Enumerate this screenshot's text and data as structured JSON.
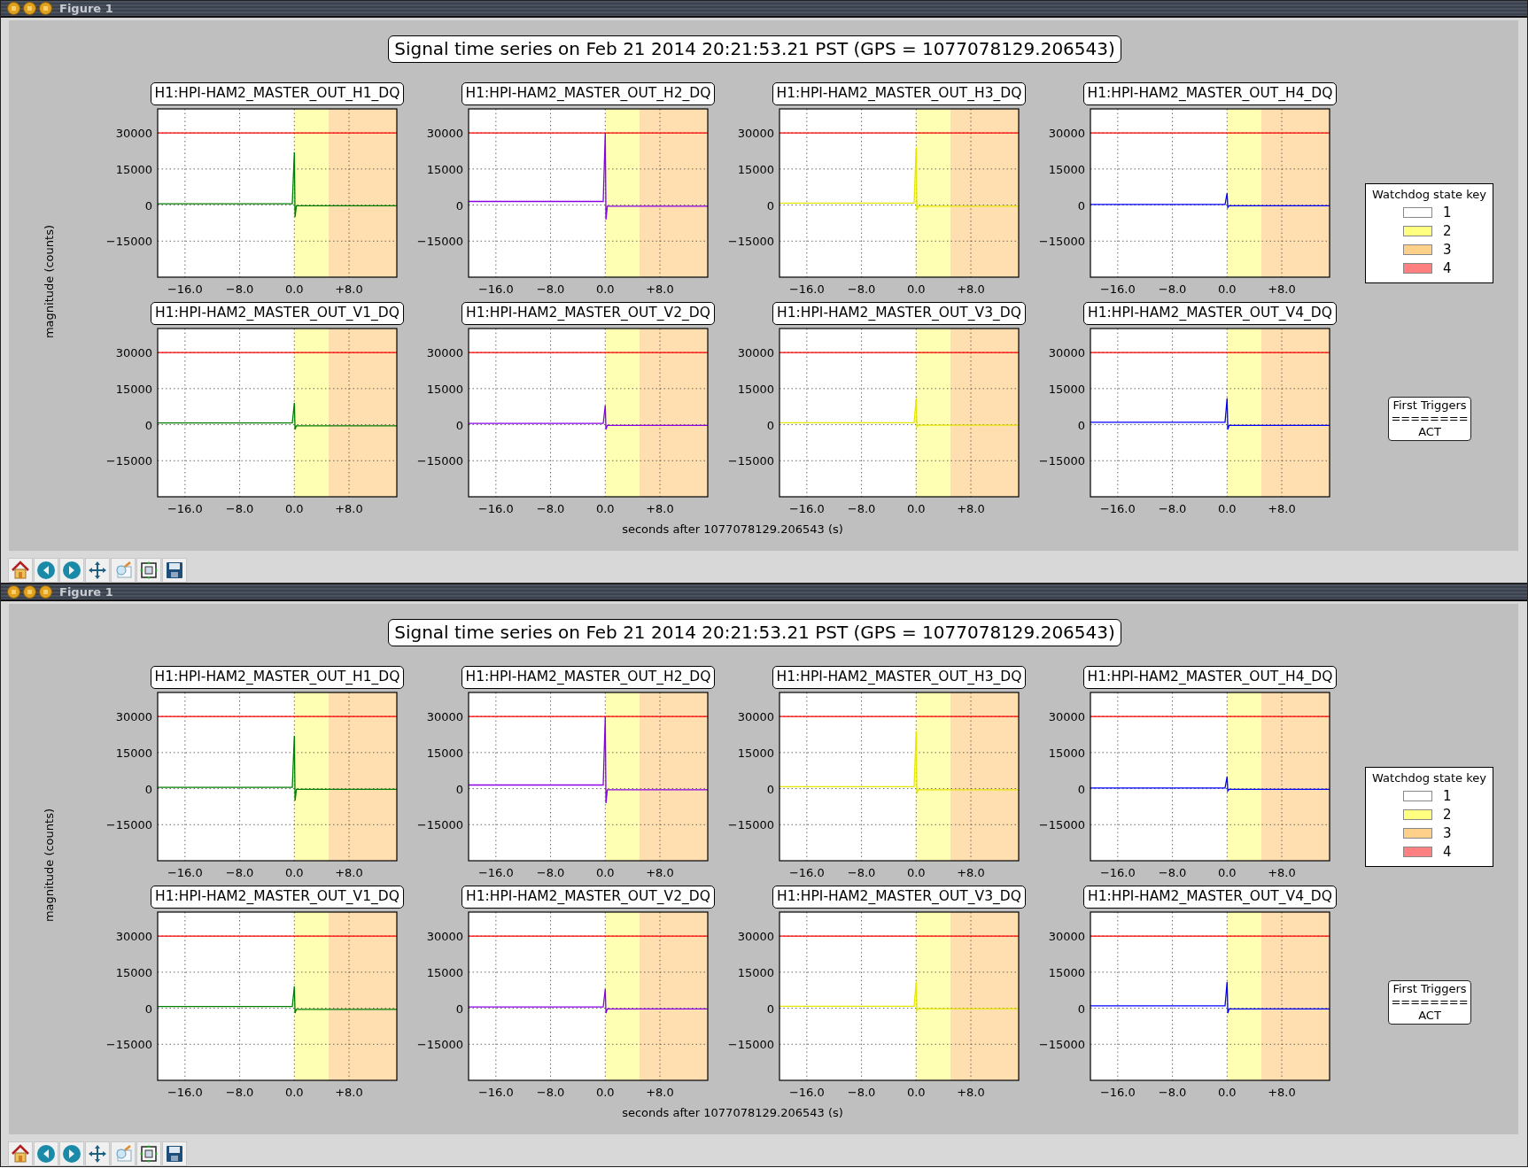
{
  "windows": [
    {
      "title": "Figure 1",
      "figure": {
        "title": "Signal time series on Feb 21 2014 20:21:53.21 PST (GPS = 1077078129.206543)",
        "ylabel": "magnitude (counts)",
        "xlabel": "seconds after 1077078129.206543 (s)",
        "plots": [
          {
            "chart_data": {
              "type": "line",
              "title": "H1:HPI-HAM2_MASTER_OUT_H1_DQ",
              "grid": true,
              "xlim": [
                -20,
                15
              ],
              "ylim": [
                -30000,
                40000
              ],
              "xticks": [
                {
                  "value": -16,
                  "label": "−16.0"
                },
                {
                  "value": -8,
                  "label": "−8.0"
                },
                {
                  "value": 0,
                  "label": "0.0"
                },
                {
                  "value": 8,
                  "label": "+8.0"
                }
              ],
              "yticks": [
                {
                  "value": 30000,
                  "label": "30000"
                },
                {
                  "value": 15000,
                  "label": "15000"
                },
                {
                  "value": 0,
                  "label": "0"
                },
                {
                  "value": -15000,
                  "label": "−15000"
                }
              ],
              "x": [
                -20,
                -0.3,
                0,
                0.1,
                0.3,
                15
              ],
              "series": [
                {
                  "color": "#007f00",
                  "values": [
                    500,
                    500,
                    22000,
                    -5000,
                    -300,
                    -300
                  ]
                }
              ],
              "ref_lines": [
                {
                  "axis": "y",
                  "value": 30000,
                  "color": "#ff0000"
                }
              ],
              "bands": [
                {
                  "axis": "x",
                  "from": 0,
                  "to": 5,
                  "color": "#ffffb3"
                },
                {
                  "axis": "x",
                  "from": 5,
                  "to": 15,
                  "color": "#ffdfb0"
                }
              ]
            }
          },
          {
            "chart_data": {
              "type": "line",
              "title": "H1:HPI-HAM2_MASTER_OUT_H2_DQ",
              "grid": true,
              "xlim": [
                -20,
                15
              ],
              "ylim": [
                -30000,
                40000
              ],
              "xticks": [
                {
                  "value": -16,
                  "label": "−16.0"
                },
                {
                  "value": -8,
                  "label": "−8.0"
                },
                {
                  "value": 0,
                  "label": "0.0"
                },
                {
                  "value": 8,
                  "label": "+8.0"
                }
              ],
              "yticks": [
                {
                  "value": 30000,
                  "label": "30000"
                },
                {
                  "value": 15000,
                  "label": "15000"
                },
                {
                  "value": 0,
                  "label": "0"
                },
                {
                  "value": -15000,
                  "label": "−15000"
                }
              ],
              "x": [
                -20,
                -0.3,
                0,
                0.1,
                0.3,
                15
              ],
              "series": [
                {
                  "color": "#8a00e6",
                  "values": [
                    1500,
                    1500,
                    30000,
                    -6000,
                    -500,
                    -500
                  ]
                }
              ],
              "ref_lines": [
                {
                  "axis": "y",
                  "value": 30000,
                  "color": "#ff0000"
                }
              ],
              "bands": [
                {
                  "axis": "x",
                  "from": 0,
                  "to": 5,
                  "color": "#ffffb3"
                },
                {
                  "axis": "x",
                  "from": 5,
                  "to": 15,
                  "color": "#ffdfb0"
                }
              ]
            }
          },
          {
            "chart_data": {
              "type": "line",
              "title": "H1:HPI-HAM2_MASTER_OUT_H3_DQ",
              "grid": true,
              "xlim": [
                -20,
                15
              ],
              "ylim": [
                -30000,
                40000
              ],
              "xticks": [
                {
                  "value": -16,
                  "label": "−16.0"
                },
                {
                  "value": -8,
                  "label": "−8.0"
                },
                {
                  "value": 0,
                  "label": "0.0"
                },
                {
                  "value": 8,
                  "label": "+8.0"
                }
              ],
              "yticks": [
                {
                  "value": 30000,
                  "label": "30000"
                },
                {
                  "value": 15000,
                  "label": "15000"
                },
                {
                  "value": 0,
                  "label": "0"
                },
                {
                  "value": -15000,
                  "label": "−15000"
                }
              ],
              "x": [
                -20,
                -0.3,
                0,
                0.1,
                0.3,
                15
              ],
              "series": [
                {
                  "color": "#e6e600",
                  "values": [
                    800,
                    800,
                    24000,
                    -2000,
                    -500,
                    -500
                  ]
                }
              ],
              "ref_lines": [
                {
                  "axis": "y",
                  "value": 30000,
                  "color": "#ff0000"
                }
              ],
              "bands": [
                {
                  "axis": "x",
                  "from": 0,
                  "to": 5,
                  "color": "#ffffb3"
                },
                {
                  "axis": "x",
                  "from": 5,
                  "to": 15,
                  "color": "#ffdfb0"
                }
              ]
            }
          },
          {
            "chart_data": {
              "type": "line",
              "title": "H1:HPI-HAM2_MASTER_OUT_H4_DQ",
              "grid": true,
              "xlim": [
                -20,
                15
              ],
              "ylim": [
                -30000,
                40000
              ],
              "xticks": [
                {
                  "value": -16,
                  "label": "−16.0"
                },
                {
                  "value": -8,
                  "label": "−8.0"
                },
                {
                  "value": 0,
                  "label": "0.0"
                },
                {
                  "value": 8,
                  "label": "+8.0"
                }
              ],
              "yticks": [
                {
                  "value": 30000,
                  "label": "30000"
                },
                {
                  "value": 15000,
                  "label": "15000"
                },
                {
                  "value": 0,
                  "label": "0"
                },
                {
                  "value": -15000,
                  "label": "−15000"
                }
              ],
              "x": [
                -20,
                -0.3,
                0,
                0.1,
                0.3,
                15
              ],
              "series": [
                {
                  "color": "#0000ff",
                  "values": [
                    300,
                    300,
                    5000,
                    -1000,
                    -300,
                    -300
                  ]
                }
              ],
              "ref_lines": [
                {
                  "axis": "y",
                  "value": 30000,
                  "color": "#ff0000"
                }
              ],
              "bands": [
                {
                  "axis": "x",
                  "from": 0,
                  "to": 5,
                  "color": "#ffffb3"
                },
                {
                  "axis": "x",
                  "from": 5,
                  "to": 15,
                  "color": "#ffdfb0"
                }
              ]
            }
          },
          {
            "chart_data": {
              "type": "line",
              "title": "H1:HPI-HAM2_MASTER_OUT_V1_DQ",
              "grid": true,
              "xlim": [
                -20,
                15
              ],
              "ylim": [
                -30000,
                40000
              ],
              "xticks": [
                {
                  "value": -16,
                  "label": "−16.0"
                },
                {
                  "value": -8,
                  "label": "−8.0"
                },
                {
                  "value": 0,
                  "label": "0.0"
                },
                {
                  "value": 8,
                  "label": "+8.0"
                }
              ],
              "yticks": [
                {
                  "value": 30000,
                  "label": "30000"
                },
                {
                  "value": 15000,
                  "label": "15000"
                },
                {
                  "value": 0,
                  "label": "0"
                },
                {
                  "value": -15000,
                  "label": "−15000"
                }
              ],
              "x": [
                -20,
                -0.3,
                0,
                0.1,
                0.3,
                15
              ],
              "series": [
                {
                  "color": "#007f00",
                  "values": [
                    700,
                    700,
                    9000,
                    -2000,
                    -500,
                    -500
                  ]
                }
              ],
              "ref_lines": [
                {
                  "axis": "y",
                  "value": 30000,
                  "color": "#ff0000"
                }
              ],
              "bands": [
                {
                  "axis": "x",
                  "from": 0,
                  "to": 5,
                  "color": "#ffffb3"
                },
                {
                  "axis": "x",
                  "from": 5,
                  "to": 15,
                  "color": "#ffdfb0"
                }
              ]
            }
          },
          {
            "chart_data": {
              "type": "line",
              "title": "H1:HPI-HAM2_MASTER_OUT_V2_DQ",
              "grid": true,
              "xlim": [
                -20,
                15
              ],
              "ylim": [
                -30000,
                40000
              ],
              "xticks": [
                {
                  "value": -16,
                  "label": "−16.0"
                },
                {
                  "value": -8,
                  "label": "−8.0"
                },
                {
                  "value": 0,
                  "label": "0.0"
                },
                {
                  "value": 8,
                  "label": "+8.0"
                }
              ],
              "yticks": [
                {
                  "value": 30000,
                  "label": "30000"
                },
                {
                  "value": 15000,
                  "label": "15000"
                },
                {
                  "value": 0,
                  "label": "0"
                },
                {
                  "value": -15000,
                  "label": "−15000"
                }
              ],
              "x": [
                -20,
                -0.3,
                0,
                0.1,
                0.3,
                15
              ],
              "series": [
                {
                  "color": "#8a00e6",
                  "values": [
                    500,
                    500,
                    8000,
                    -2000,
                    -300,
                    -300
                  ]
                }
              ],
              "ref_lines": [
                {
                  "axis": "y",
                  "value": 30000,
                  "color": "#ff0000"
                }
              ],
              "bands": [
                {
                  "axis": "x",
                  "from": 0,
                  "to": 5,
                  "color": "#ffffb3"
                },
                {
                  "axis": "x",
                  "from": 5,
                  "to": 15,
                  "color": "#ffdfb0"
                }
              ]
            }
          },
          {
            "chart_data": {
              "type": "line",
              "title": "H1:HPI-HAM2_MASTER_OUT_V3_DQ",
              "grid": true,
              "xlim": [
                -20,
                15
              ],
              "ylim": [
                -30000,
                40000
              ],
              "xticks": [
                {
                  "value": -16,
                  "label": "−16.0"
                },
                {
                  "value": -8,
                  "label": "−8.0"
                },
                {
                  "value": 0,
                  "label": "0.0"
                },
                {
                  "value": 8,
                  "label": "+8.0"
                }
              ],
              "yticks": [
                {
                  "value": 30000,
                  "label": "30000"
                },
                {
                  "value": 15000,
                  "label": "15000"
                },
                {
                  "value": 0,
                  "label": "0"
                },
                {
                  "value": -15000,
                  "label": "−15000"
                }
              ],
              "x": [
                -20,
                -0.3,
                0,
                0.1,
                0.3,
                15
              ],
              "series": [
                {
                  "color": "#e6e600",
                  "values": [
                    800,
                    800,
                    11000,
                    -1000,
                    -200,
                    -200
                  ]
                }
              ],
              "ref_lines": [
                {
                  "axis": "y",
                  "value": 30000,
                  "color": "#ff0000"
                }
              ],
              "bands": [
                {
                  "axis": "x",
                  "from": 0,
                  "to": 5,
                  "color": "#ffffb3"
                },
                {
                  "axis": "x",
                  "from": 5,
                  "to": 15,
                  "color": "#ffdfb0"
                }
              ]
            }
          },
          {
            "chart_data": {
              "type": "line",
              "title": "H1:HPI-HAM2_MASTER_OUT_V4_DQ",
              "grid": true,
              "xlim": [
                -20,
                15
              ],
              "ylim": [
                -30000,
                40000
              ],
              "xticks": [
                {
                  "value": -16,
                  "label": "−16.0"
                },
                {
                  "value": -8,
                  "label": "−8.0"
                },
                {
                  "value": 0,
                  "label": "0.0"
                },
                {
                  "value": 8,
                  "label": "+8.0"
                }
              ],
              "yticks": [
                {
                  "value": 30000,
                  "label": "30000"
                },
                {
                  "value": 15000,
                  "label": "15000"
                },
                {
                  "value": 0,
                  "label": "0"
                },
                {
                  "value": -15000,
                  "label": "−15000"
                }
              ],
              "x": [
                -20,
                -0.3,
                0,
                0.1,
                0.3,
                15
              ],
              "series": [
                {
                  "color": "#0000ff",
                  "values": [
                    1000,
                    1000,
                    11000,
                    -2000,
                    -300,
                    -300
                  ]
                }
              ],
              "ref_lines": [
                {
                  "axis": "y",
                  "value": 30000,
                  "color": "#ff0000"
                }
              ],
              "bands": [
                {
                  "axis": "x",
                  "from": 0,
                  "to": 5,
                  "color": "#ffffb3"
                },
                {
                  "axis": "x",
                  "from": 5,
                  "to": 15,
                  "color": "#ffdfb0"
                }
              ]
            }
          }
        ],
        "legend": {
          "title": "Watchdog state key",
          "entries": [
            {
              "label": "1",
              "color": "#ffffff"
            },
            {
              "label": "2",
              "color": "#ffff80"
            },
            {
              "label": "3",
              "color": "#ffd08a"
            },
            {
              "label": "4",
              "color": "#ff8080"
            }
          ]
        },
        "triggers": [
          "First Triggers",
          "========",
          "ACT"
        ]
      }
    },
    {
      "title": "Figure 1",
      "figure": {
        "title": "Signal time series on Feb 21 2014 20:21:53.21 PST (GPS = 1077078129.206543)",
        "ylabel": "magnitude (counts)",
        "xlabel": "seconds after 1077078129.206543 (s)",
        "plots": [
          {
            "chart_data": {
              "type": "line",
              "title": "H1:HPI-HAM2_MASTER_OUT_H1_DQ",
              "grid": true,
              "xlim": [
                -20,
                15
              ],
              "ylim": [
                -30000,
                40000
              ],
              "xticks": [
                {
                  "value": -16,
                  "label": "−16.0"
                },
                {
                  "value": -8,
                  "label": "−8.0"
                },
                {
                  "value": 0,
                  "label": "0.0"
                },
                {
                  "value": 8,
                  "label": "+8.0"
                }
              ],
              "yticks": [
                {
                  "value": 30000,
                  "label": "30000"
                },
                {
                  "value": 15000,
                  "label": "15000"
                },
                {
                  "value": 0,
                  "label": "0"
                },
                {
                  "value": -15000,
                  "label": "−15000"
                }
              ],
              "x": [
                -20,
                -0.3,
                0,
                0.1,
                0.3,
                15
              ],
              "series": [
                {
                  "color": "#007f00",
                  "values": [
                    500,
                    500,
                    22000,
                    -5000,
                    -300,
                    -300
                  ]
                }
              ],
              "ref_lines": [
                {
                  "axis": "y",
                  "value": 30000,
                  "color": "#ff0000"
                }
              ],
              "bands": [
                {
                  "axis": "x",
                  "from": 0,
                  "to": 5,
                  "color": "#ffffb3"
                },
                {
                  "axis": "x",
                  "from": 5,
                  "to": 15,
                  "color": "#ffdfb0"
                }
              ]
            }
          },
          {
            "chart_data": {
              "type": "line",
              "title": "H1:HPI-HAM2_MASTER_OUT_H2_DQ",
              "grid": true,
              "xlim": [
                -20,
                15
              ],
              "ylim": [
                -30000,
                40000
              ],
              "xticks": [
                {
                  "value": -16,
                  "label": "−16.0"
                },
                {
                  "value": -8,
                  "label": "−8.0"
                },
                {
                  "value": 0,
                  "label": "0.0"
                },
                {
                  "value": 8,
                  "label": "+8.0"
                }
              ],
              "yticks": [
                {
                  "value": 30000,
                  "label": "30000"
                },
                {
                  "value": 15000,
                  "label": "15000"
                },
                {
                  "value": 0,
                  "label": "0"
                },
                {
                  "value": -15000,
                  "label": "−15000"
                }
              ],
              "x": [
                -20,
                -0.3,
                0,
                0.1,
                0.3,
                15
              ],
              "series": [
                {
                  "color": "#8a00e6",
                  "values": [
                    1500,
                    1500,
                    30000,
                    -6000,
                    -500,
                    -500
                  ]
                }
              ],
              "ref_lines": [
                {
                  "axis": "y",
                  "value": 30000,
                  "color": "#ff0000"
                }
              ],
              "bands": [
                {
                  "axis": "x",
                  "from": 0,
                  "to": 5,
                  "color": "#ffffb3"
                },
                {
                  "axis": "x",
                  "from": 5,
                  "to": 15,
                  "color": "#ffdfb0"
                }
              ]
            }
          },
          {
            "chart_data": {
              "type": "line",
              "title": "H1:HPI-HAM2_MASTER_OUT_H3_DQ",
              "grid": true,
              "xlim": [
                -20,
                15
              ],
              "ylim": [
                -30000,
                40000
              ],
              "xticks": [
                {
                  "value": -16,
                  "label": "−16.0"
                },
                {
                  "value": -8,
                  "label": "−8.0"
                },
                {
                  "value": 0,
                  "label": "0.0"
                },
                {
                  "value": 8,
                  "label": "+8.0"
                }
              ],
              "yticks": [
                {
                  "value": 30000,
                  "label": "30000"
                },
                {
                  "value": 15000,
                  "label": "15000"
                },
                {
                  "value": 0,
                  "label": "0"
                },
                {
                  "value": -15000,
                  "label": "−15000"
                }
              ],
              "x": [
                -20,
                -0.3,
                0,
                0.1,
                0.3,
                15
              ],
              "series": [
                {
                  "color": "#e6e600",
                  "values": [
                    800,
                    800,
                    24000,
                    -2000,
                    -500,
                    -500
                  ]
                }
              ],
              "ref_lines": [
                {
                  "axis": "y",
                  "value": 30000,
                  "color": "#ff0000"
                }
              ],
              "bands": [
                {
                  "axis": "x",
                  "from": 0,
                  "to": 5,
                  "color": "#ffffb3"
                },
                {
                  "axis": "x",
                  "from": 5,
                  "to": 15,
                  "color": "#ffdfb0"
                }
              ]
            }
          },
          {
            "chart_data": {
              "type": "line",
              "title": "H1:HPI-HAM2_MASTER_OUT_H4_DQ",
              "grid": true,
              "xlim": [
                -20,
                15
              ],
              "ylim": [
                -30000,
                40000
              ],
              "xticks": [
                {
                  "value": -16,
                  "label": "−16.0"
                },
                {
                  "value": -8,
                  "label": "−8.0"
                },
                {
                  "value": 0,
                  "label": "0.0"
                },
                {
                  "value": 8,
                  "label": "+8.0"
                }
              ],
              "yticks": [
                {
                  "value": 30000,
                  "label": "30000"
                },
                {
                  "value": 15000,
                  "label": "15000"
                },
                {
                  "value": 0,
                  "label": "0"
                },
                {
                  "value": -15000,
                  "label": "−15000"
                }
              ],
              "x": [
                -20,
                -0.3,
                0,
                0.1,
                0.3,
                15
              ],
              "series": [
                {
                  "color": "#0000ff",
                  "values": [
                    300,
                    300,
                    5000,
                    -1000,
                    -300,
                    -300
                  ]
                }
              ],
              "ref_lines": [
                {
                  "axis": "y",
                  "value": 30000,
                  "color": "#ff0000"
                }
              ],
              "bands": [
                {
                  "axis": "x",
                  "from": 0,
                  "to": 5,
                  "color": "#ffffb3"
                },
                {
                  "axis": "x",
                  "from": 5,
                  "to": 15,
                  "color": "#ffdfb0"
                }
              ]
            }
          },
          {
            "chart_data": {
              "type": "line",
              "title": "H1:HPI-HAM2_MASTER_OUT_V1_DQ",
              "grid": true,
              "xlim": [
                -20,
                15
              ],
              "ylim": [
                -30000,
                40000
              ],
              "xticks": [
                {
                  "value": -16,
                  "label": "−16.0"
                },
                {
                  "value": -8,
                  "label": "−8.0"
                },
                {
                  "value": 0,
                  "label": "0.0"
                },
                {
                  "value": 8,
                  "label": "+8.0"
                }
              ],
              "yticks": [
                {
                  "value": 30000,
                  "label": "30000"
                },
                {
                  "value": 15000,
                  "label": "15000"
                },
                {
                  "value": 0,
                  "label": "0"
                },
                {
                  "value": -15000,
                  "label": "−15000"
                }
              ],
              "x": [
                -20,
                -0.3,
                0,
                0.1,
                0.3,
                15
              ],
              "series": [
                {
                  "color": "#007f00",
                  "values": [
                    700,
                    700,
                    9000,
                    -2000,
                    -500,
                    -500
                  ]
                }
              ],
              "ref_lines": [
                {
                  "axis": "y",
                  "value": 30000,
                  "color": "#ff0000"
                }
              ],
              "bands": [
                {
                  "axis": "x",
                  "from": 0,
                  "to": 5,
                  "color": "#ffffb3"
                },
                {
                  "axis": "x",
                  "from": 5,
                  "to": 15,
                  "color": "#ffdfb0"
                }
              ]
            }
          },
          {
            "chart_data": {
              "type": "line",
              "title": "H1:HPI-HAM2_MASTER_OUT_V2_DQ",
              "grid": true,
              "xlim": [
                -20,
                15
              ],
              "ylim": [
                -30000,
                40000
              ],
              "xticks": [
                {
                  "value": -16,
                  "label": "−16.0"
                },
                {
                  "value": -8,
                  "label": "−8.0"
                },
                {
                  "value": 0,
                  "label": "0.0"
                },
                {
                  "value": 8,
                  "label": "+8.0"
                }
              ],
              "yticks": [
                {
                  "value": 30000,
                  "label": "30000"
                },
                {
                  "value": 15000,
                  "label": "15000"
                },
                {
                  "value": 0,
                  "label": "0"
                },
                {
                  "value": -15000,
                  "label": "−15000"
                }
              ],
              "x": [
                -20,
                -0.3,
                0,
                0.1,
                0.3,
                15
              ],
              "series": [
                {
                  "color": "#8a00e6",
                  "values": [
                    500,
                    500,
                    8000,
                    -2000,
                    -300,
                    -300
                  ]
                }
              ],
              "ref_lines": [
                {
                  "axis": "y",
                  "value": 30000,
                  "color": "#ff0000"
                }
              ],
              "bands": [
                {
                  "axis": "x",
                  "from": 0,
                  "to": 5,
                  "color": "#ffffb3"
                },
                {
                  "axis": "x",
                  "from": 5,
                  "to": 15,
                  "color": "#ffdfb0"
                }
              ]
            }
          },
          {
            "chart_data": {
              "type": "line",
              "title": "H1:HPI-HAM2_MASTER_OUT_V3_DQ",
              "grid": true,
              "xlim": [
                -20,
                15
              ],
              "ylim": [
                -30000,
                40000
              ],
              "xticks": [
                {
                  "value": -16,
                  "label": "−16.0"
                },
                {
                  "value": -8,
                  "label": "−8.0"
                },
                {
                  "value": 0,
                  "label": "0.0"
                },
                {
                  "value": 8,
                  "label": "+8.0"
                }
              ],
              "yticks": [
                {
                  "value": 30000,
                  "label": "30000"
                },
                {
                  "value": 15000,
                  "label": "15000"
                },
                {
                  "value": 0,
                  "label": "0"
                },
                {
                  "value": -15000,
                  "label": "−15000"
                }
              ],
              "x": [
                -20,
                -0.3,
                0,
                0.1,
                0.3,
                15
              ],
              "series": [
                {
                  "color": "#e6e600",
                  "values": [
                    800,
                    800,
                    11000,
                    -1000,
                    -200,
                    -200
                  ]
                }
              ],
              "ref_lines": [
                {
                  "axis": "y",
                  "value": 30000,
                  "color": "#ff0000"
                }
              ],
              "bands": [
                {
                  "axis": "x",
                  "from": 0,
                  "to": 5,
                  "color": "#ffffb3"
                },
                {
                  "axis": "x",
                  "from": 5,
                  "to": 15,
                  "color": "#ffdfb0"
                }
              ]
            }
          },
          {
            "chart_data": {
              "type": "line",
              "title": "H1:HPI-HAM2_MASTER_OUT_V4_DQ",
              "grid": true,
              "xlim": [
                -20,
                15
              ],
              "ylim": [
                -30000,
                40000
              ],
              "xticks": [
                {
                  "value": -16,
                  "label": "−16.0"
                },
                {
                  "value": -8,
                  "label": "−8.0"
                },
                {
                  "value": 0,
                  "label": "0.0"
                },
                {
                  "value": 8,
                  "label": "+8.0"
                }
              ],
              "yticks": [
                {
                  "value": 30000,
                  "label": "30000"
                },
                {
                  "value": 15000,
                  "label": "15000"
                },
                {
                  "value": 0,
                  "label": "0"
                },
                {
                  "value": -15000,
                  "label": "−15000"
                }
              ],
              "x": [
                -20,
                -0.3,
                0,
                0.1,
                0.3,
                15
              ],
              "series": [
                {
                  "color": "#0000ff",
                  "values": [
                    1000,
                    1000,
                    11000,
                    -2000,
                    -300,
                    -300
                  ]
                }
              ],
              "ref_lines": [
                {
                  "axis": "y",
                  "value": 30000,
                  "color": "#ff0000"
                }
              ],
              "bands": [
                {
                  "axis": "x",
                  "from": 0,
                  "to": 5,
                  "color": "#ffffb3"
                },
                {
                  "axis": "x",
                  "from": 5,
                  "to": 15,
                  "color": "#ffdfb0"
                }
              ]
            }
          }
        ],
        "legend": {
          "title": "Watchdog state key",
          "entries": [
            {
              "label": "1",
              "color": "#ffffff"
            },
            {
              "label": "2",
              "color": "#ffff80"
            },
            {
              "label": "3",
              "color": "#ffd08a"
            },
            {
              "label": "4",
              "color": "#ff8080"
            }
          ]
        },
        "triggers": [
          "First Triggers",
          "========",
          "ACT"
        ]
      }
    }
  ]
}
